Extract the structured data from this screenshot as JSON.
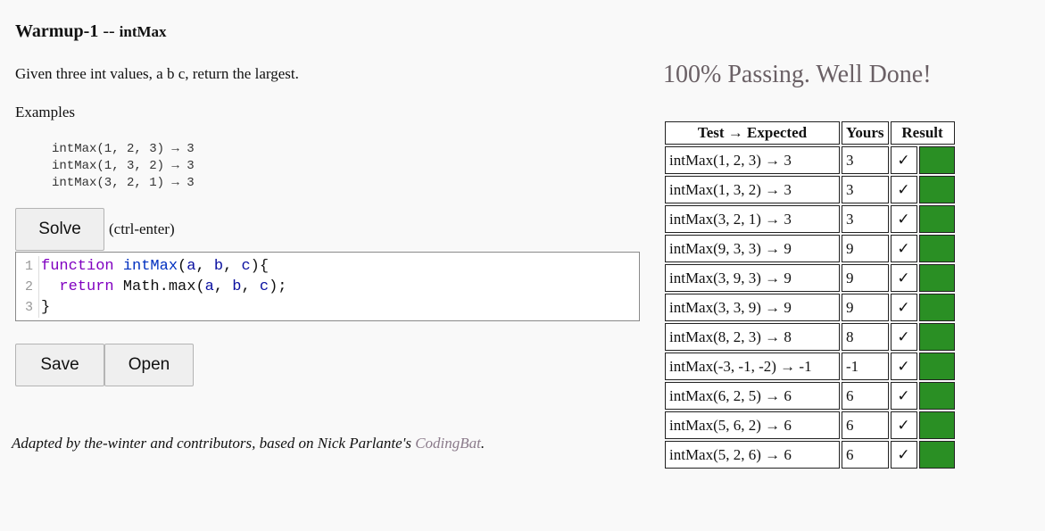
{
  "problem": {
    "category": "Warmup-1",
    "separator": " -- ",
    "name": "intMax",
    "description": "Given three int values, a b c, return the largest.",
    "examples_label": "Examples",
    "examples": [
      "intMax(1, 2, 3) → 3",
      "intMax(1, 3, 2) → 3",
      "intMax(3, 2, 1) → 3"
    ]
  },
  "controls": {
    "solve_label": "Solve",
    "solve_hint": "(ctrl-enter)",
    "save_label": "Save",
    "open_label": "Open"
  },
  "editor": {
    "line_numbers": [
      "1",
      "2",
      "3"
    ]
  },
  "footer": {
    "credit_text": "Adapted by the-winter and contributors, based on Nick Parlante's ",
    "credit_link": "CodingBat",
    "credit_end": "."
  },
  "results": {
    "status": "100% Passing. Well Done!",
    "headers": [
      "Test → Expected",
      "Yours",
      "Result"
    ],
    "check_mark": "✓",
    "pass_color": "#2a8f24",
    "rows": [
      {
        "test": "intMax(1, 2, 3) → 3",
        "yours": "3"
      },
      {
        "test": "intMax(1, 3, 2) → 3",
        "yours": "3"
      },
      {
        "test": "intMax(3, 2, 1) → 3",
        "yours": "3"
      },
      {
        "test": "intMax(9, 3, 3) → 9",
        "yours": "9"
      },
      {
        "test": "intMax(3, 9, 3) → 9",
        "yours": "9"
      },
      {
        "test": "intMax(3, 3, 9) → 9",
        "yours": "9"
      },
      {
        "test": "intMax(8, 2, 3) → 8",
        "yours": "8"
      },
      {
        "test": "intMax(-3, -1, -2) → -1",
        "yours": "-1"
      },
      {
        "test": "intMax(6, 2, 5) → 6",
        "yours": "6"
      },
      {
        "test": "intMax(5, 6, 2) → 6",
        "yours": "6"
      },
      {
        "test": "intMax(5, 2, 6) → 6",
        "yours": "6"
      }
    ]
  }
}
